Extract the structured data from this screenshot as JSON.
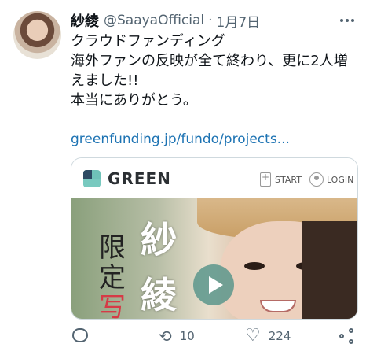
{
  "tweet": {
    "author_name": "紗綾",
    "handle": "@SaayaOfficial",
    "separator": "·",
    "date": "1月7日",
    "lines": [
      "クラウドファンディング",
      "海外ファンの反映が全て終わり、更に2人増",
      "えました!!",
      "本当にありがとう。"
    ],
    "link": "greenfunding.jp/fundo/projects..."
  },
  "card": {
    "brand": "GREEN",
    "start_label": "START",
    "login_label": "LOGIN",
    "image_text": {
      "big_1": "紗",
      "big_2": "綾",
      "small_1": "限",
      "small_2": "定",
      "small_3": "写"
    }
  },
  "actions": {
    "retweet_count": "10",
    "like_count": "224"
  },
  "icons": [
    "more-icon",
    "reply-icon",
    "retweet-icon",
    "like-icon",
    "share-icon",
    "play-icon",
    "document-add-icon",
    "user-icon"
  ]
}
